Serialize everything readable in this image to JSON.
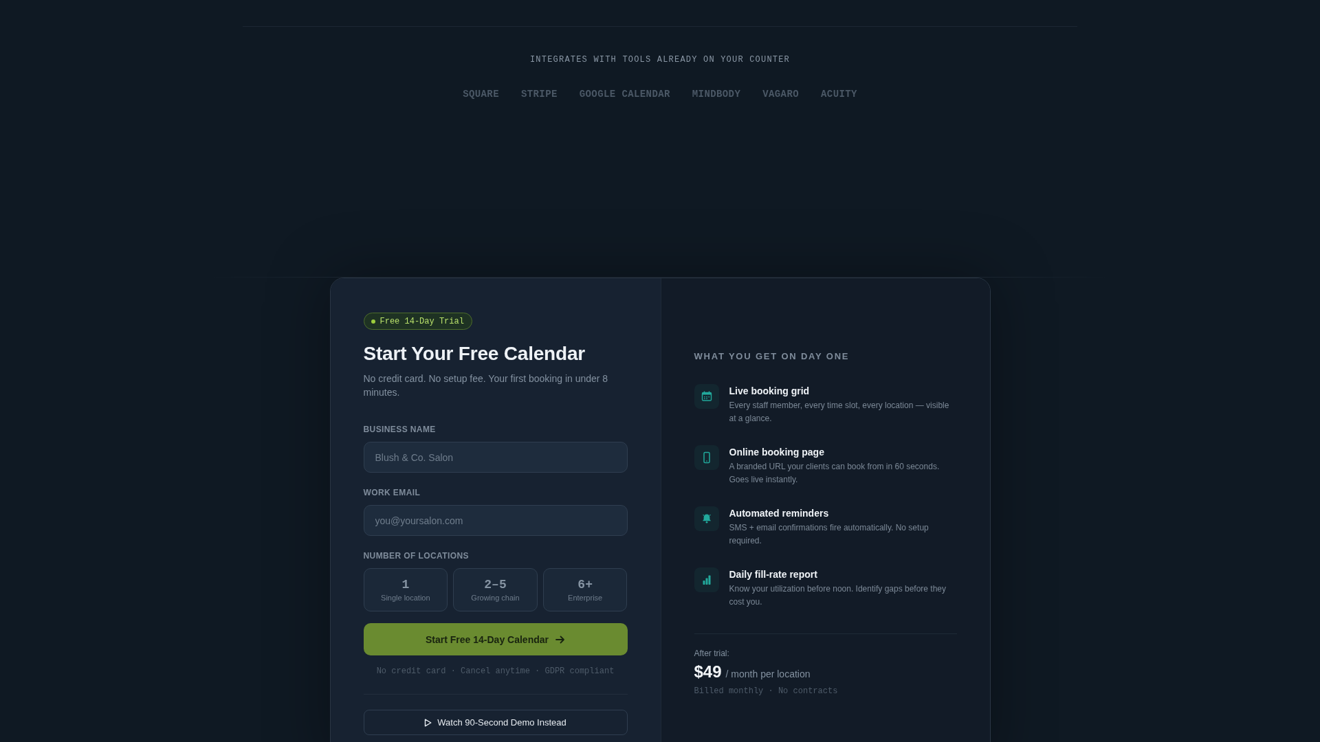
{
  "integrations": {
    "caption": "INTEGRATES WITH TOOLS ALREADY ON YOUR COUNTER",
    "logos": [
      "SQUARE",
      "STRIPE",
      "GOOGLE CALENDAR",
      "MINDBODY",
      "VAGARO",
      "ACUITY"
    ]
  },
  "signup": {
    "badge": "Free 14-Day Trial",
    "title": "Start Your Free Calendar",
    "subtitle": "No credit card. No setup fee. Your first booking in under 8 minutes.",
    "fields": [
      {
        "label": "BUSINESS NAME",
        "placeholder": "Blush & Co. Salon"
      },
      {
        "label": "WORK EMAIL",
        "placeholder": "you@yoursalon.com"
      }
    ],
    "locations": {
      "label": "NUMBER OF LOCATIONS",
      "options": [
        {
          "value": "1",
          "caption": "Single location",
          "selected": false
        },
        {
          "value": "2–5",
          "caption": "Growing chain",
          "selected": false
        },
        {
          "value": "6+",
          "caption": "Enterprise",
          "selected": false
        }
      ]
    },
    "submit": "Start Free 14-Day Calendar",
    "fine_print": "No credit card · Cancel anytime · GDPR compliant",
    "demo_button": "Watch 90-Second Demo Instead"
  },
  "benefits": {
    "heading": "WHAT YOU GET ON DAY ONE",
    "items": [
      {
        "title": "Live booking grid",
        "description": "Every staff member, every time slot, every location — visible at a glance."
      },
      {
        "title": "Online booking page",
        "description": "A branded URL your clients can book from in 60 seconds. Goes live instantly."
      },
      {
        "title": "Automated reminders",
        "description": "SMS + email confirmations fire automatically. No setup required."
      },
      {
        "title": "Daily fill-rate report",
        "description": "Know your utilization before noon. Identify gaps before they cost you."
      }
    ],
    "pricing": {
      "label": "After trial:",
      "price": "$49",
      "unit": "/ month per location",
      "note": "Billed monthly · No contracts"
    }
  }
}
